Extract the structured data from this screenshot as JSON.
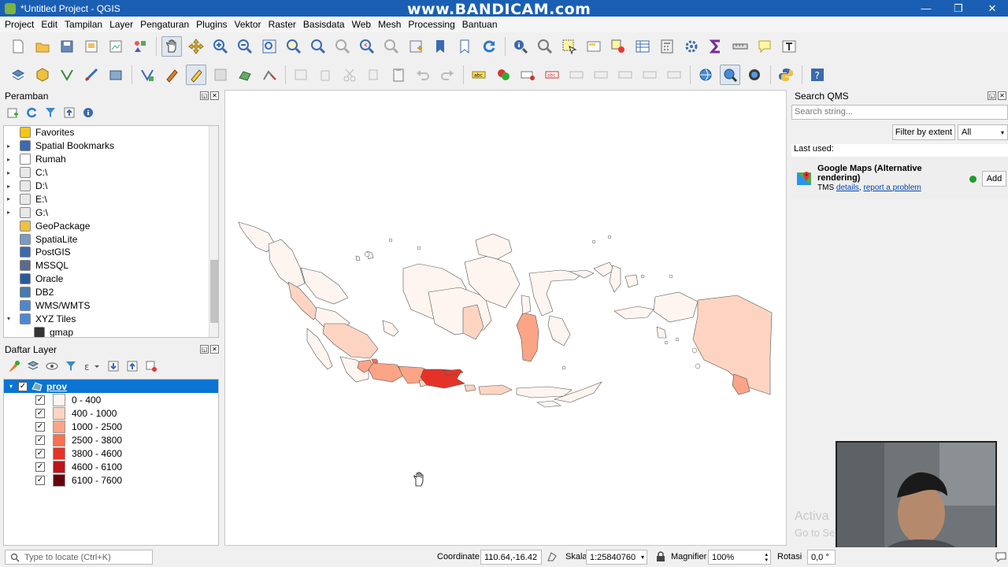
{
  "window": {
    "title": "*Untitled Project - QGIS",
    "watermark": "www.BANDICAM.com"
  },
  "menu": [
    "Project",
    "Edit",
    "Tampilan",
    "Layer",
    "Pengaturan",
    "Plugins",
    "Vektor",
    "Raster",
    "Basisdata",
    "Web",
    "Mesh",
    "Processing",
    "Bantuan"
  ],
  "browser": {
    "title": "Peramban",
    "items": [
      {
        "label": "Favorites",
        "icon": "star-icon",
        "arrow": ""
      },
      {
        "label": "Spatial Bookmarks",
        "icon": "bookmark-icon",
        "arrow": "▸"
      },
      {
        "label": "Rumah",
        "icon": "home-icon",
        "arrow": "▸"
      },
      {
        "label": "C:\\",
        "icon": "drive-icon",
        "arrow": "▸"
      },
      {
        "label": "D:\\",
        "icon": "drive-icon",
        "arrow": "▸"
      },
      {
        "label": "E:\\",
        "icon": "drive-icon",
        "arrow": "▸"
      },
      {
        "label": "G:\\",
        "icon": "drive-icon",
        "arrow": "▸"
      },
      {
        "label": "GeoPackage",
        "icon": "geopackage-icon",
        "arrow": ""
      },
      {
        "label": "SpatiaLite",
        "icon": "spatialite-icon",
        "arrow": ""
      },
      {
        "label": "PostGIS",
        "icon": "postgis-icon",
        "arrow": ""
      },
      {
        "label": "MSSQL",
        "icon": "mssql-icon",
        "arrow": ""
      },
      {
        "label": "Oracle",
        "icon": "oracle-icon",
        "arrow": ""
      },
      {
        "label": "DB2",
        "icon": "db2-icon",
        "arrow": ""
      },
      {
        "label": "WMS/WMTS",
        "icon": "globe-icon",
        "arrow": ""
      },
      {
        "label": "XYZ Tiles",
        "icon": "globe-icon",
        "arrow": "▾"
      },
      {
        "label": "gmap",
        "icon": "tiles-icon",
        "arrow": ""
      }
    ]
  },
  "layers": {
    "title": "Daftar Layer",
    "layer_name": "prov",
    "legend": [
      {
        "label": "0 - 400",
        "color": "#fff5f0"
      },
      {
        "label": "400 - 1000",
        "color": "#fdd4c2"
      },
      {
        "label": "1000 - 2500",
        "color": "#fca486"
      },
      {
        "label": "2500 - 3800",
        "color": "#fb7050"
      },
      {
        "label": "3800 - 4600",
        "color": "#e53228"
      },
      {
        "label": "4600 - 6100",
        "color": "#bb141a"
      },
      {
        "label": "6100 - 7600",
        "color": "#67000d"
      }
    ]
  },
  "qms": {
    "title": "Search QMS",
    "search_placeholder": "Search string...",
    "filter_button": "Filter by extent",
    "filter_value": "All",
    "last_used_label": "Last used:",
    "service_name": "Google Maps (Alternative rendering)",
    "service_type": "TMS",
    "details_link": "details",
    "report_link": "report a problem",
    "add_button": "Add",
    "activate_text": "Activa",
    "goto_text": "Go to Se"
  },
  "status": {
    "locate_placeholder": "Type to locate (Ctrl+K)",
    "coordinate_label": "Coordinate",
    "coordinate_value": "110.64,-16.42",
    "scale_label": "Skala",
    "scale_value": "1:25840760",
    "magnifier_label": "Magnifier",
    "magnifier_value": "100%",
    "rotation_label": "Rotasi",
    "rotation_value": "0,0 °"
  }
}
